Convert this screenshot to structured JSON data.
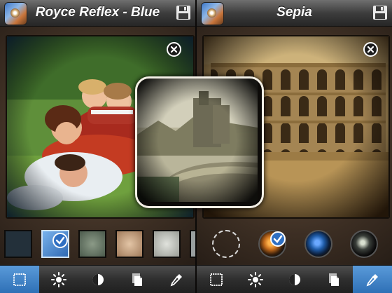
{
  "left_panel": {
    "title": "Royce Reflex - Blue",
    "icons": {
      "app": "app-icon",
      "save": "floppy-disk-icon",
      "close": "close-circle-icon"
    },
    "frames": [
      {
        "id": "frame-1",
        "selected": false,
        "color": "#23303a"
      },
      {
        "id": "frame-2",
        "selected": true,
        "color": "#3d7fcf"
      },
      {
        "id": "frame-3",
        "selected": false,
        "color": "#6c7b6d"
      },
      {
        "id": "frame-4",
        "selected": false,
        "color": "#c9a68a"
      },
      {
        "id": "frame-5",
        "selected": false,
        "color": "#c6c9c2"
      }
    ],
    "toolbar": [
      {
        "name": "frame-tool",
        "icon": "frame-icon",
        "active": true
      },
      {
        "name": "brightness-tool",
        "icon": "sun-icon",
        "active": false
      },
      {
        "name": "contrast-tool",
        "icon": "contrast-icon",
        "active": false
      },
      {
        "name": "texture-tool",
        "icon": "layers-icon",
        "active": false
      },
      {
        "name": "color-picker-tool",
        "icon": "eyedropper-icon",
        "active": false
      }
    ]
  },
  "right_panel": {
    "title": "Sepia",
    "icons": {
      "app": "app-icon",
      "save": "floppy-disk-icon",
      "close": "close-circle-icon"
    },
    "lenses": [
      {
        "id": "no-lens",
        "selected": false
      },
      {
        "id": "amber-lens",
        "selected": true,
        "color": "#c36b1c"
      },
      {
        "id": "blue-lens",
        "selected": false,
        "color": "#1f5ca8"
      },
      {
        "id": "dark-lens",
        "selected": false,
        "color": "#3a3f3a"
      }
    ],
    "toolbar": [
      {
        "name": "frame-tool",
        "icon": "frame-icon",
        "active": false
      },
      {
        "name": "brightness-tool",
        "icon": "sun-icon",
        "active": false
      },
      {
        "name": "contrast-tool",
        "icon": "contrast-icon",
        "active": false
      },
      {
        "name": "texture-tool",
        "icon": "layers-icon",
        "active": false
      },
      {
        "name": "color-picker-tool",
        "icon": "eyedropper-icon",
        "active": true
      }
    ]
  },
  "colors": {
    "accent": "#3b82d0",
    "active_tool": "#3a7fc6",
    "sepia": "#b8924f"
  }
}
